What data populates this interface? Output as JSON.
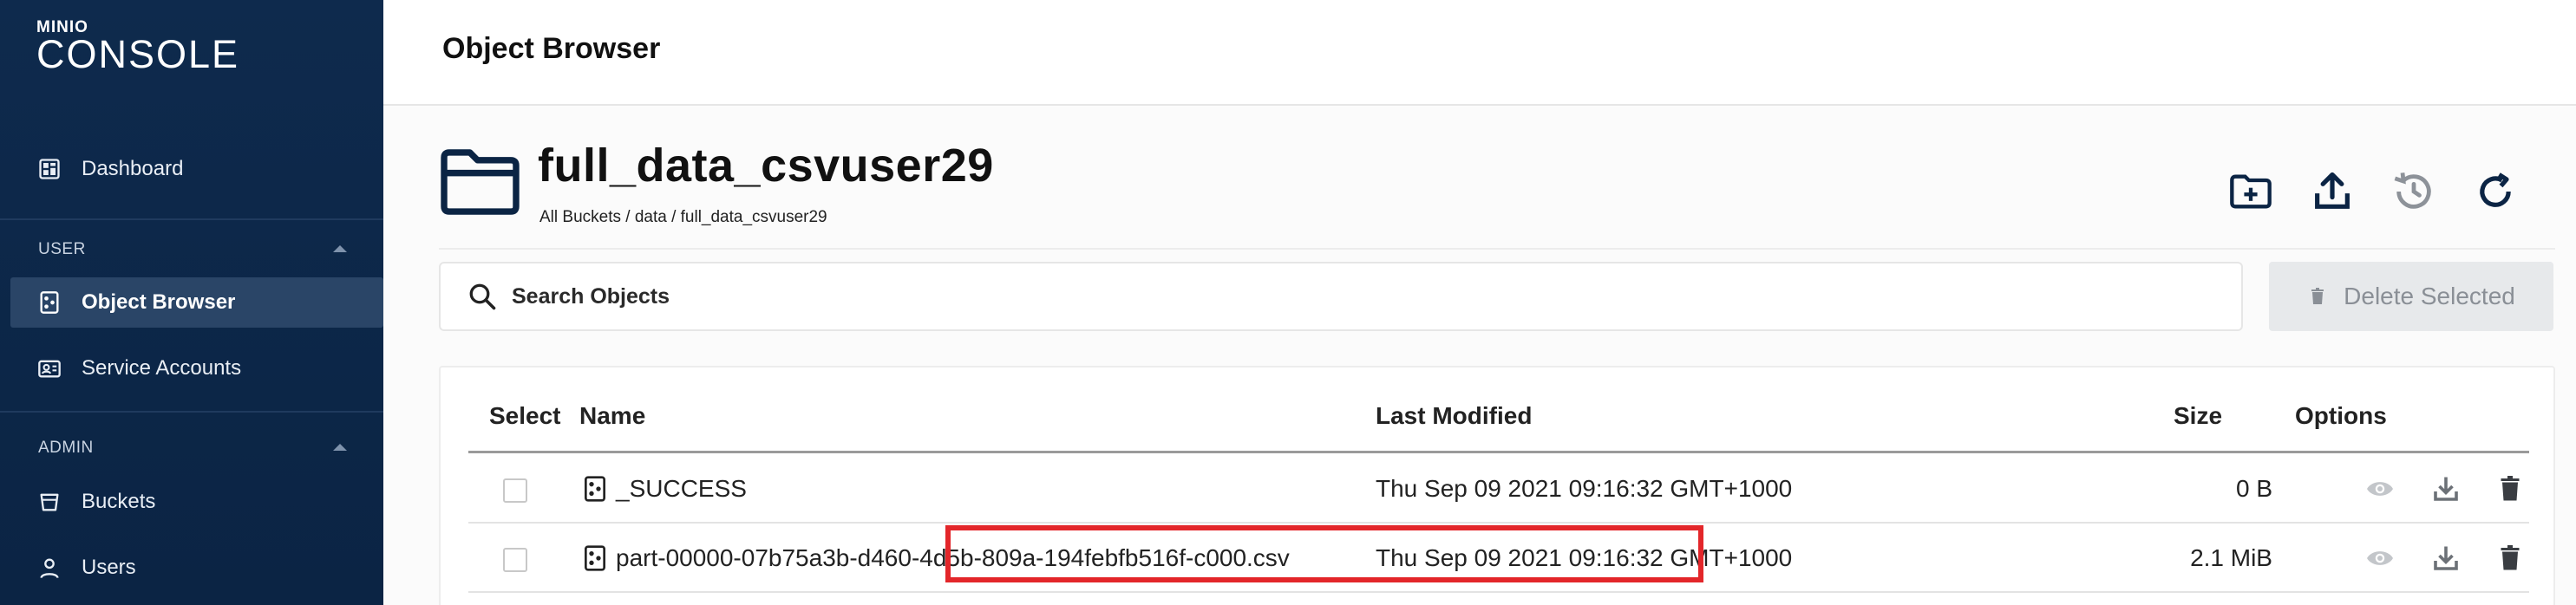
{
  "sidebar": {
    "logo_top": "MINIO",
    "logo_main": "CONSOLE",
    "dashboard": "Dashboard",
    "section_user": "USER",
    "object_browser": "Object Browser",
    "service_accounts": "Service Accounts",
    "section_admin": "ADMIN",
    "buckets": "Buckets",
    "users": "Users"
  },
  "header": {
    "title": "Object Browser"
  },
  "bucket": {
    "name": "full_data_csvuser29",
    "breadcrumb": "All Buckets / data / full_data_csvuser29"
  },
  "search": {
    "placeholder": "Search Objects",
    "value": ""
  },
  "delete_selected": "Delete Selected",
  "table": {
    "columns": {
      "select": "Select",
      "name": "Name",
      "last_modified": "Last Modified",
      "size": "Size",
      "options": "Options"
    },
    "rows": [
      {
        "name": "_SUCCESS",
        "last_modified": "Thu Sep 09 2021 09:16:32 GMT+1000",
        "size": "0 B"
      },
      {
        "name": "part-00000-07b75a3b-d460-4d5b-809a-194febfb516f-c000.csv",
        "last_modified": "Thu Sep 09 2021 09:16:32 GMT+1000",
        "size": "2.1 MiB"
      }
    ]
  },
  "colors": {
    "sidebar_bg": "#0e2a4d",
    "active_item": "#2a4567",
    "highlight": "#e3262a",
    "icon_dark": "#0b2444"
  }
}
